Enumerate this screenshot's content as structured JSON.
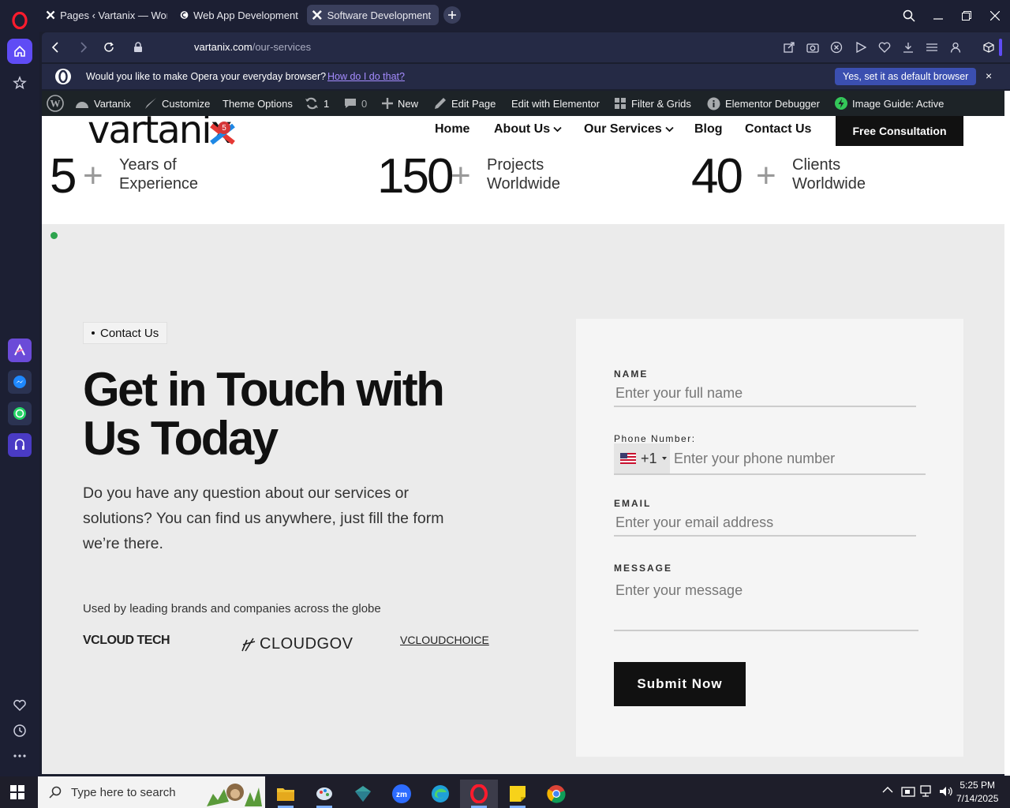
{
  "browser": {
    "tabs": [
      {
        "title": "Pages ‹ Vartanix — WordPress"
      },
      {
        "title": "Web App Development Company"
      },
      {
        "title": "Software Development & IT"
      }
    ],
    "url_host": "vartanix.com",
    "url_path": "/our-services",
    "banner": {
      "question": "Would you like to make Opera your everyday browser?",
      "how": "How do I do that?",
      "yes": "Yes, set it as default browser",
      "close": "×"
    }
  },
  "wpbar": {
    "site": "Vartanix",
    "customize": "Customize",
    "theme_options": "Theme Options",
    "updates": "1",
    "comments": "0",
    "new": "New",
    "edit_page": "Edit Page",
    "edit_elementor": "Edit with Elementor",
    "filter_grids": "Filter & Grids",
    "debugger": "Elementor Debugger",
    "image_guide": "Image Guide: Active"
  },
  "site": {
    "logo": "vartanix",
    "badge": "5",
    "nav": [
      "Home",
      "About Us",
      "Our Services",
      "Blog",
      "Contact Us"
    ],
    "cta": "Free Consultation"
  },
  "stats": [
    {
      "num": "5",
      "plus": "+",
      "l1": "Years of",
      "l2": "Experience"
    },
    {
      "num": "150",
      "plus": "+",
      "l1": "Projects",
      "l2": "Worldwide"
    },
    {
      "num": "40",
      "plus": "+",
      "l1": "Clients",
      "l2": "Worldwide"
    }
  ],
  "contact": {
    "chip": "Contact Us",
    "heading_l1": "Get in Touch with",
    "heading_l2": "Us Today",
    "desc": "Do you have any question about our services or solutions? You can find us anywhere, just fill the form we’re there.",
    "brands_label": "Used by leading brands and companies across the globe",
    "brands": [
      "VCLOUD TECH",
      "CLOUDGOV",
      "VCLOUDCHOICE"
    ]
  },
  "form": {
    "name_label": "NAME",
    "name_ph": "Enter your full name",
    "phone_label": "Phone Number:",
    "phone_code": "+1",
    "phone_ph": "Enter your phone number",
    "email_label": "EMAIL",
    "email_ph": "Enter your email address",
    "message_label": "MESSAGE",
    "message_ph": "Enter your message",
    "submit": "Submit Now"
  },
  "taskbar": {
    "search_ph": "Type here to search",
    "time": "5:25 PM",
    "date": "7/14/2025"
  },
  "colors": {
    "opera_red": "#ff1b2d",
    "accent_purple": "#5f4cf5",
    "wp_bar": "#1d2327",
    "page_bg": "#ebebeb",
    "form_bg": "#f5f5f5",
    "cta_black": "#111111"
  }
}
